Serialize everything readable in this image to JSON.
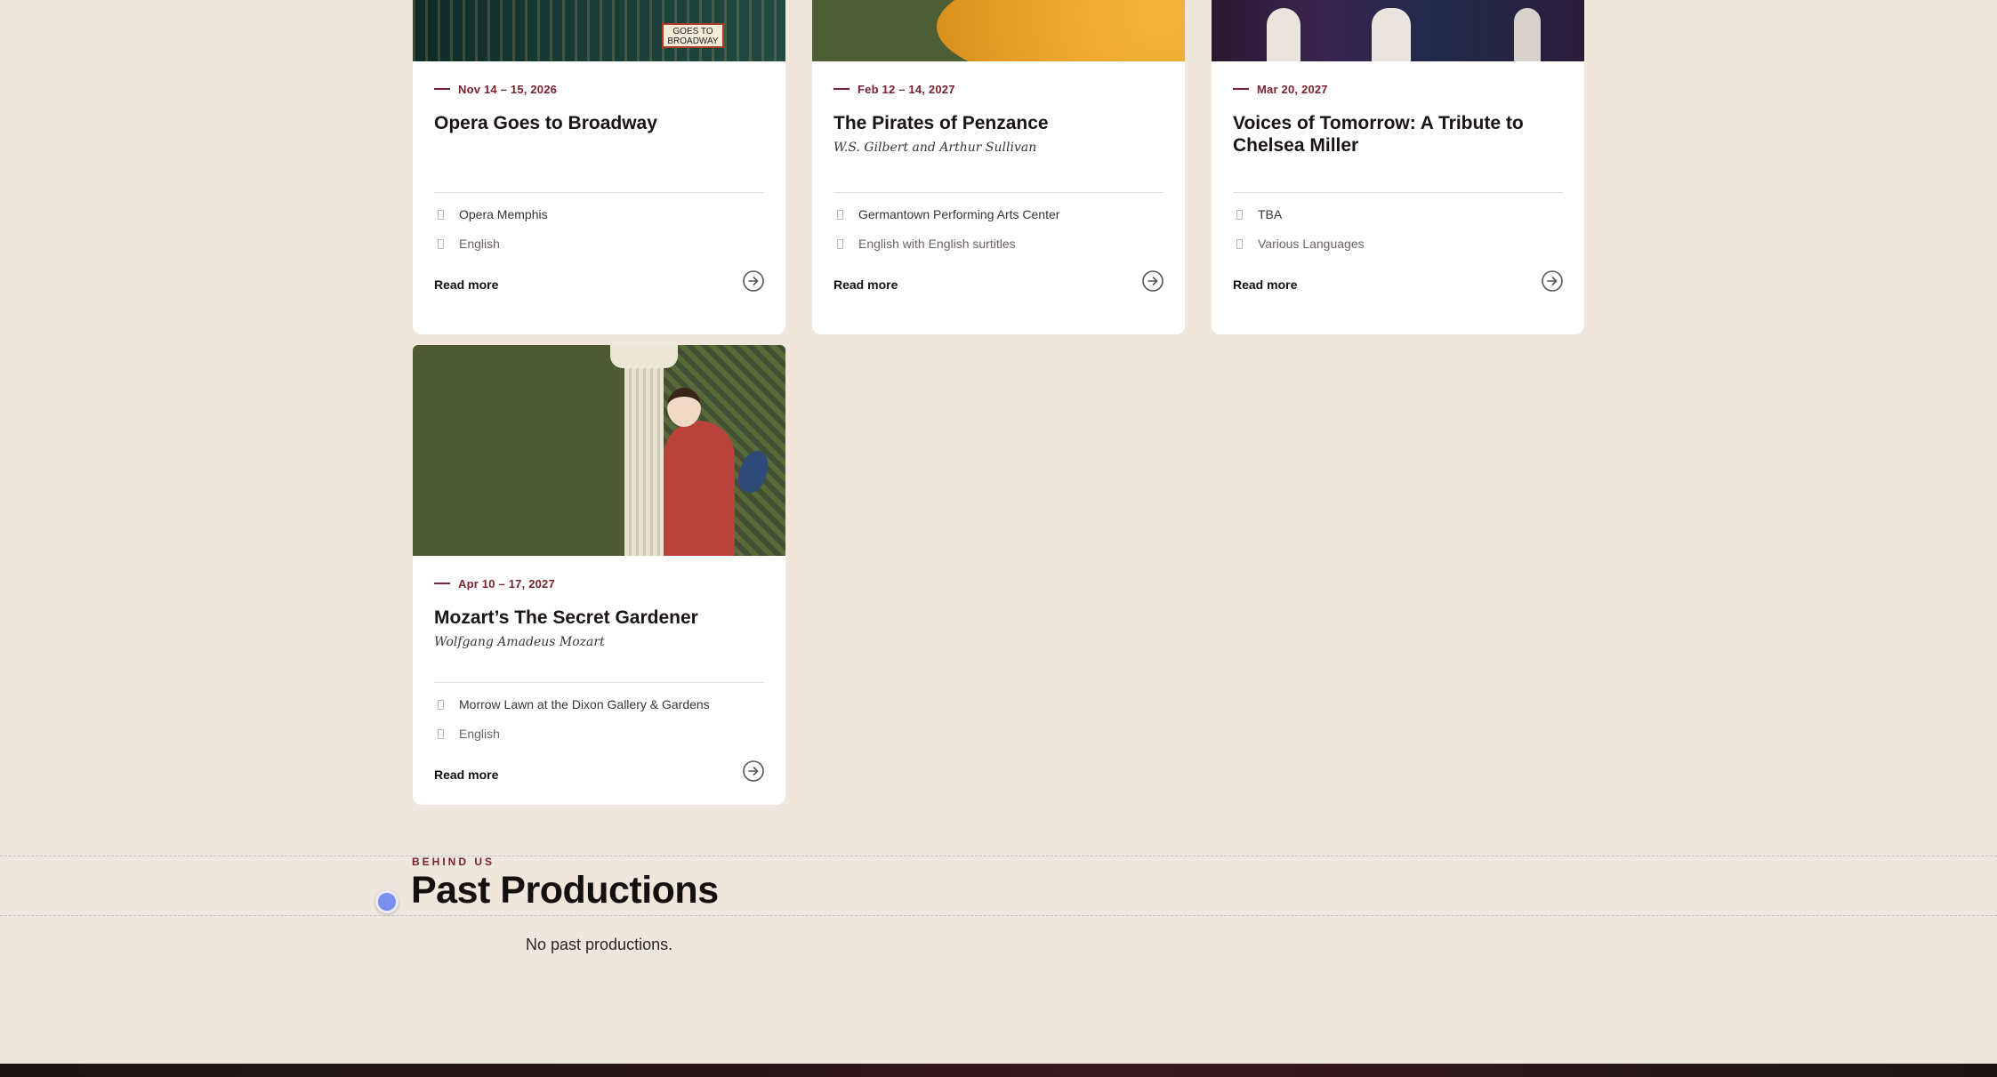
{
  "events": [
    {
      "date": "Nov 14 – 15, 2026",
      "title": "Opera Goes to Broadway",
      "subtitle": "",
      "venue": "Opera Memphis",
      "language": "English",
      "read_more": "Read more",
      "image_sign": "GOES TO BROADWAY"
    },
    {
      "date": "Feb 12 – 14, 2027",
      "title": "The Pirates of Penzance",
      "subtitle": "W.S. Gilbert and Arthur Sullivan",
      "venue": "Germantown Performing Arts Center",
      "language": "English with English surtitles",
      "read_more": "Read more"
    },
    {
      "date": "Mar 20, 2027",
      "title": "Voices of Tomorrow: A Tribute to Chelsea Miller",
      "subtitle": "",
      "venue": "TBA",
      "language": "Various Languages",
      "read_more": "Read more"
    },
    {
      "date": "Apr 10 – 17, 2027",
      "title": "Mozart’s The Secret Gardener",
      "subtitle": "Wolfgang Amadeus Mozart",
      "venue": "Morrow Lawn at the Dixon Gallery & Gardens",
      "language": "English",
      "read_more": "Read more"
    }
  ],
  "past": {
    "eyebrow": "BEHIND US",
    "title": "Past Productions",
    "empty_text": "No past productions."
  },
  "colors": {
    "accent": "#7a2230",
    "page_bg": "#efe7dc",
    "card_bg": "#ffffff"
  }
}
